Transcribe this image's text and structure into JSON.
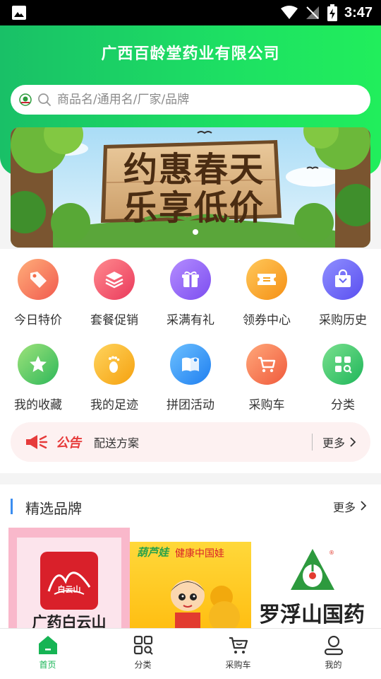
{
  "status_bar": {
    "time": "3:47"
  },
  "header": {
    "title": "广西百龄堂药业有限公司",
    "search_placeholder": "商品名/通用名/厂家/品牌"
  },
  "banner": {
    "line1": "约惠春天",
    "line2": "乐享低价"
  },
  "shortcuts": [
    {
      "label": "今日特价",
      "icon": "price-tag-icon",
      "color": "#f56d4a"
    },
    {
      "label": "套餐促销",
      "icon": "layers-icon",
      "color": "#f0506a"
    },
    {
      "label": "采满有礼",
      "icon": "gift-icon",
      "color": "#8a5ef0"
    },
    {
      "label": "领券中心",
      "icon": "coupon-icon",
      "color": "#f7a21b"
    },
    {
      "label": "采购历史",
      "icon": "shopping-bag-icon",
      "color": "#6a6cf2"
    },
    {
      "label": "我的收藏",
      "icon": "star-icon",
      "color": "#43c46a"
    },
    {
      "label": "我的足迹",
      "icon": "footprint-icon",
      "color": "#f6b21c"
    },
    {
      "label": "拼团活动",
      "icon": "book-icon",
      "color": "#2d8df0"
    },
    {
      "label": "采购车",
      "icon": "cart-icon",
      "color": "#f56d4a"
    },
    {
      "label": "分类",
      "icon": "category-icon",
      "color": "#2fc16a"
    }
  ],
  "notice": {
    "tag": "公告",
    "text": "配送方案",
    "more": "更多"
  },
  "brands": {
    "title": "精选品牌",
    "more": "更多",
    "items": [
      {
        "name": "广药白云山",
        "logo_text": "白云山"
      },
      {
        "name": "葫芦娃",
        "slogan": "健康中国娃"
      },
      {
        "name": "罗浮山国药"
      }
    ]
  },
  "tabbar": [
    {
      "label": "首页",
      "icon": "home-icon",
      "active": true
    },
    {
      "label": "分类",
      "icon": "category-grid-icon",
      "active": false
    },
    {
      "label": "采购车",
      "icon": "cart-icon",
      "active": false
    },
    {
      "label": "我的",
      "icon": "user-icon",
      "active": false
    }
  ]
}
